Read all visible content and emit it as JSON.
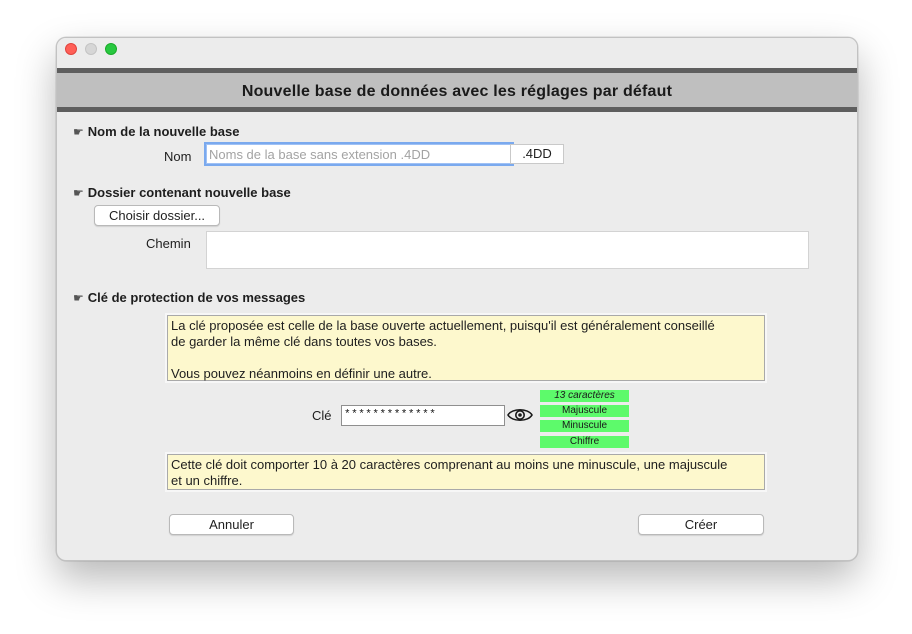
{
  "window": {
    "traffic_lights": [
      "close",
      "minimize",
      "maximize"
    ]
  },
  "header": {
    "title": "Nouvelle base de données avec les réglages par défaut"
  },
  "section_name": {
    "icon": "pointing-hand-icon",
    "title": "Nom de la nouvelle base",
    "field_label": "Nom",
    "input_value": "",
    "input_placeholder": "Noms de la base sans extension .4DD",
    "extension": ".4DD"
  },
  "section_folder": {
    "icon": "pointing-hand-icon",
    "title": "Dossier contenant nouvelle base",
    "choose_button": "Choisir dossier...",
    "path_label": "Chemin",
    "path_value": ""
  },
  "section_key": {
    "icon": "pointing-hand-icon",
    "title": "Clé de protection de vos messages",
    "info_line1": "La clé proposée est celle de la base ouverte actuellement, puisqu'il est généralement conseillé",
    "info_line2": "de garder la même clé dans toutes vos bases.",
    "info_line3": "Vous pouvez néanmoins en définir une autre.",
    "key_label": "Clé",
    "key_value": "*************",
    "eye_icon": "eye-icon",
    "badges": {
      "count": "13 caractères",
      "upper": "Majuscule",
      "lower": "Minuscule",
      "digit": "Chiffre"
    },
    "badge_color": "#5dfa6b",
    "rule_line1": "Cette clé doit comporter 10 à 20 caractères comprenant au moins une minuscule, une majuscule",
    "rule_line2": "et un chiffre."
  },
  "footer": {
    "cancel_label": "Annuler",
    "create_label": "Créer"
  },
  "colors": {
    "note_background": "#fdf8cd",
    "header_background": "#bfbfbf",
    "header_border": "#5e5e5e"
  }
}
